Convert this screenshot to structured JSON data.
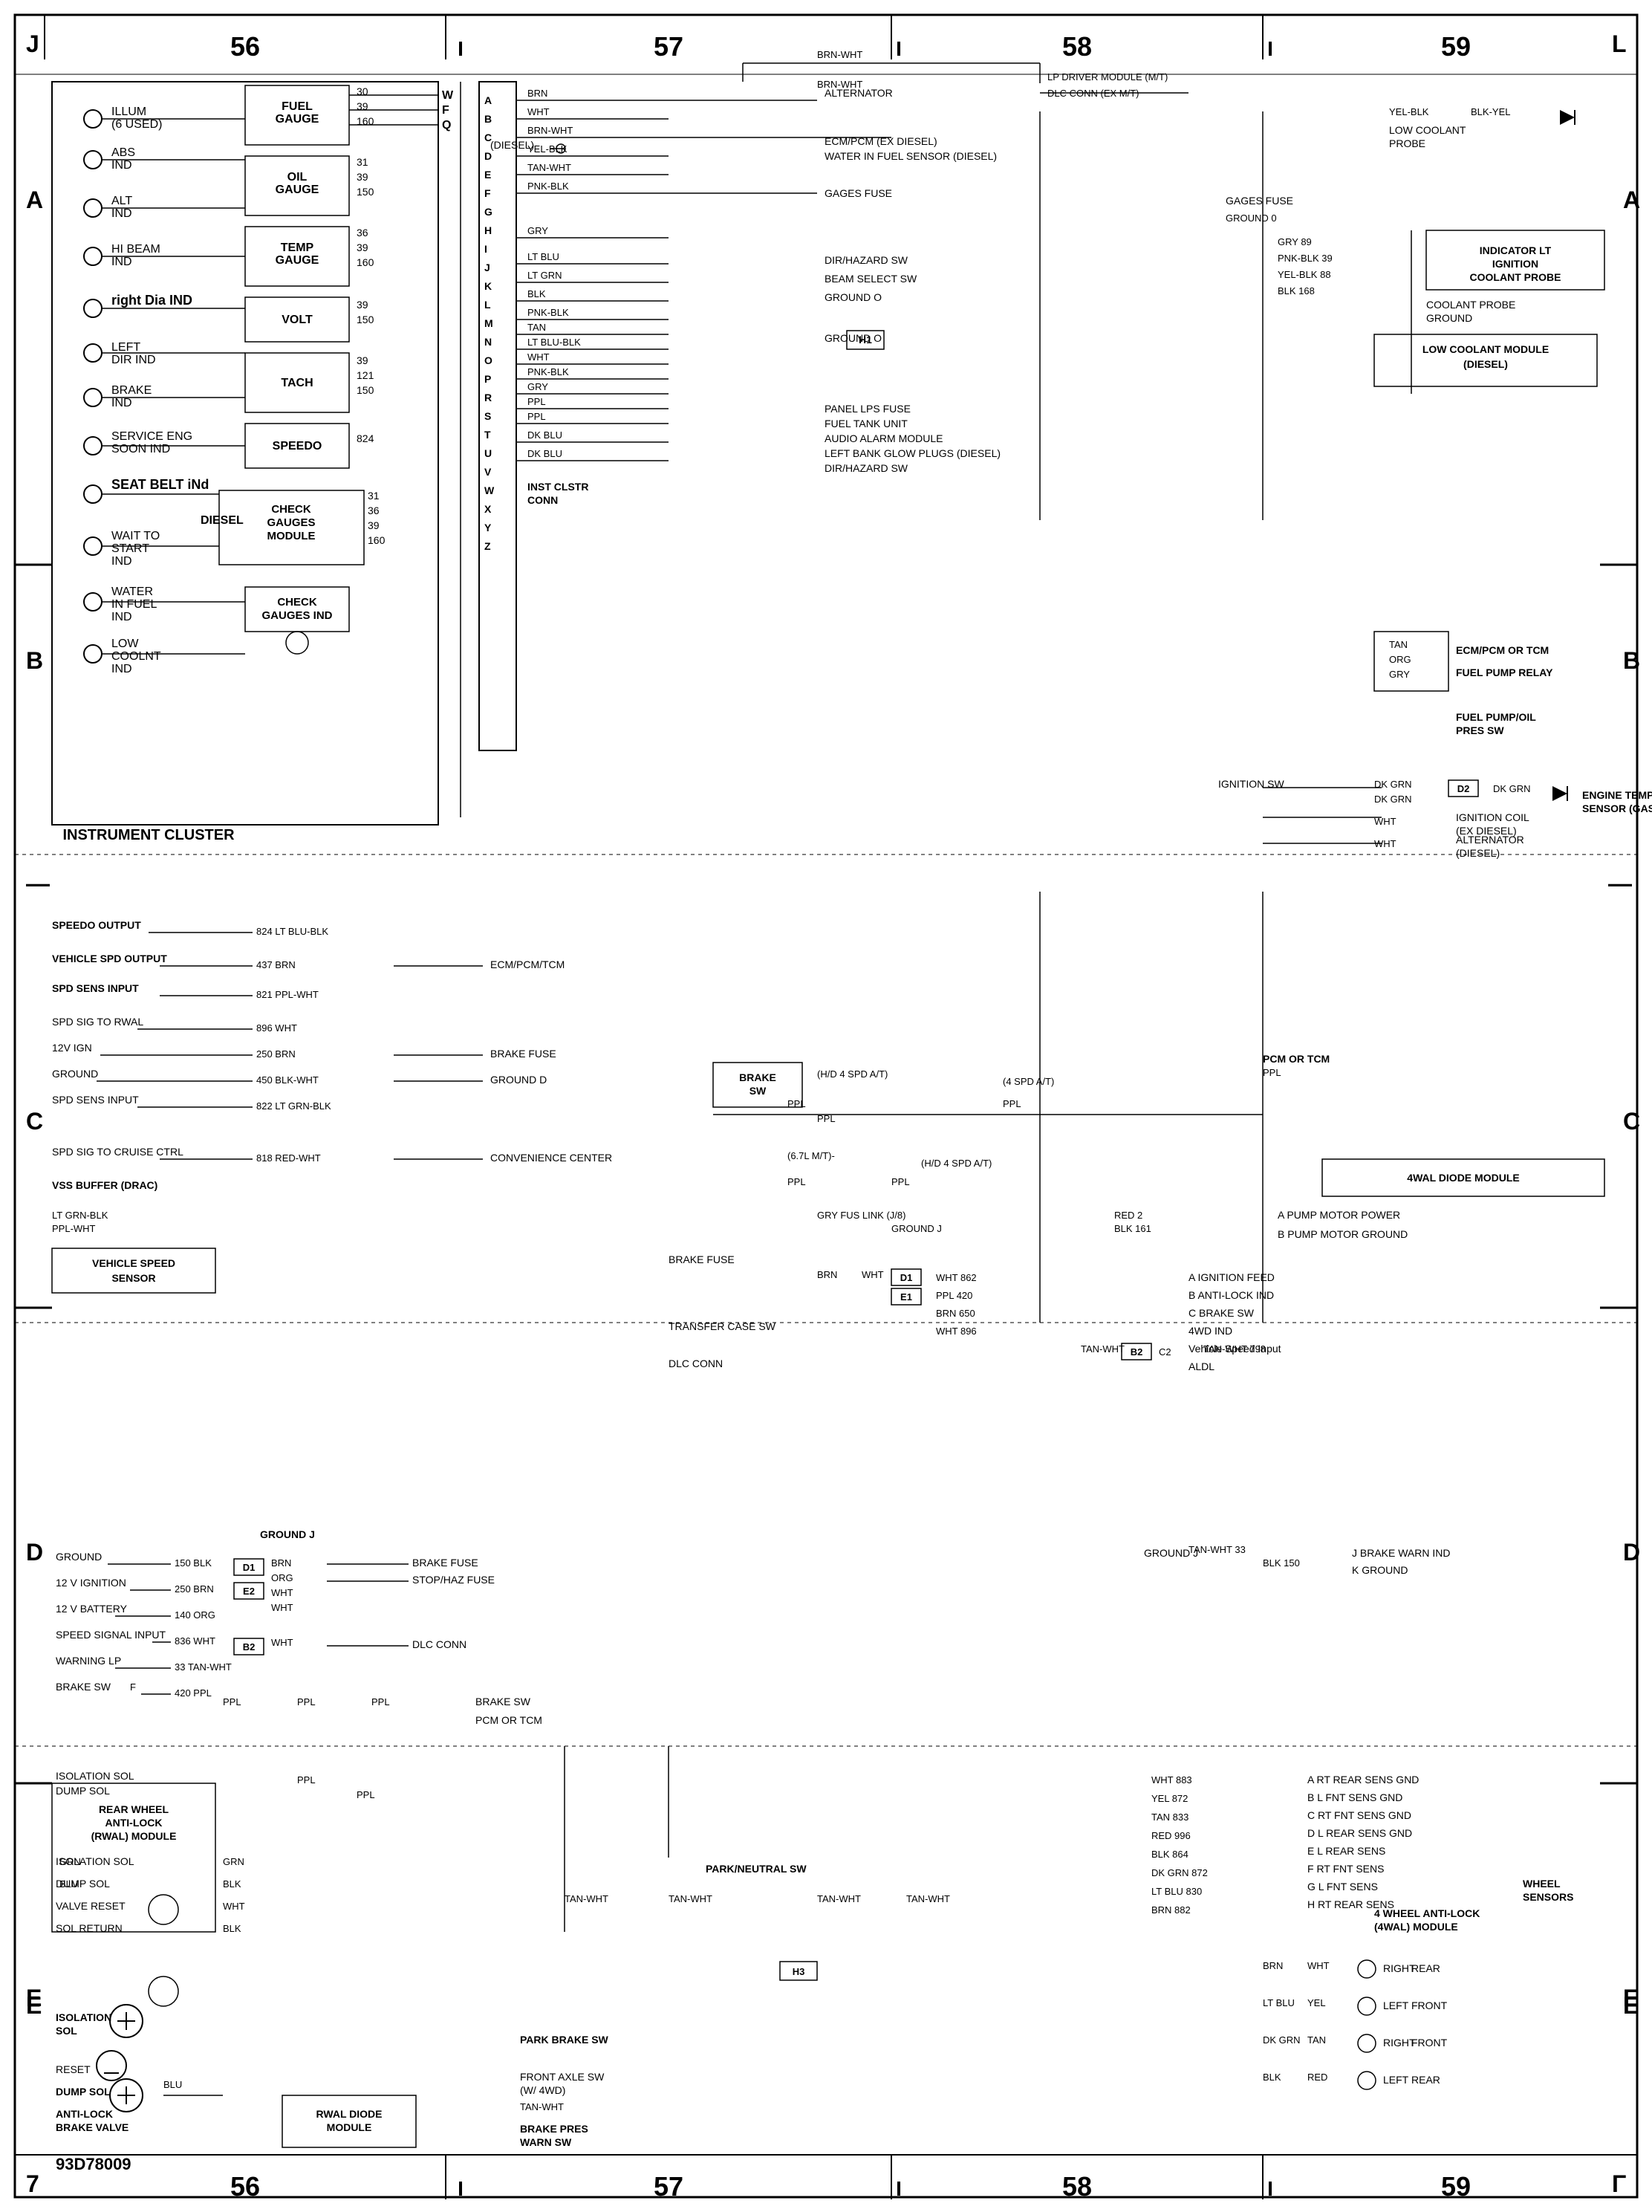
{
  "title": "93D78009 Instrument Cluster Wiring Diagram",
  "columns": [
    "56",
    "57",
    "58",
    "59"
  ],
  "rows": [
    "A",
    "B",
    "C",
    "D",
    "E"
  ],
  "doc_number": "93D78009",
  "gauges": {
    "fuel_gauge": {
      "label": "FUEL GAUGE",
      "values": [
        "30",
        "39",
        "160"
      ]
    },
    "oil_gauge": {
      "label": "OIL GAUGE",
      "values": [
        "31",
        "39",
        "150"
      ]
    },
    "temp_gauge": {
      "label": "TEMP GAUGE",
      "values": [
        "36",
        "39",
        "160"
      ]
    },
    "volt": {
      "label": "VOLT",
      "values": [
        "39",
        "150"
      ]
    },
    "tach": {
      "label": "TACH",
      "values": [
        "39",
        "121",
        "150"
      ]
    },
    "speedo": {
      "label": "SPEEDO",
      "values": [
        "824"
      ]
    },
    "check_gauges_module": {
      "label": "CHECK GAUGES MODULE"
    },
    "check_gauges_ind": {
      "label": "CHECK GAUGES IND"
    },
    "diesel": {
      "label": "DIESEL"
    }
  },
  "indicators": {
    "illum": "ILLUM (6 USED)",
    "abs_ind": "ABS IND",
    "alt_ind": "ALT IND",
    "hi_beam_ind": "HI BEAM IND",
    "right_dir_ind": "RIGHT DIR IND",
    "left_dir_ind": "LEFT DIR IND",
    "brake_ind": "BRAKE IND",
    "service_eng_soon": "SERVICE ENG SOON IND",
    "seat_belt_ind": "SEAT BELT IND",
    "wait_to_start": "WAIT TO START IND",
    "water_in_fuel": "WATER IN FUEL IND",
    "low_coolnt": "LOW COOLNT IND"
  },
  "modules": {
    "instrument_cluster": "INSTRUMENT CLUSTER",
    "rwal_module": "REAR WHEEL ANTI-LOCK (RWAL) MODULE",
    "four_wal_module": "4 WHEEL ANTI-LOCK (4WAL) MODULE",
    "rwal_diode": "RWAL DIODE MODULE",
    "convenience_center": "CONVENIENCE CENTER",
    "ecm_pcm_tcm": "ECM/PCM/TCM",
    "four_wal_diode": "4WAL DIODE MODULE",
    "lp_driver": "LP DRIVER MODULE (M/T)",
    "dlc_conn": "DLC CONN (EX M/T)",
    "alternator": "ALTERNATOR",
    "ecm_pcm_ex": "ECM/PCM (EX DIESEL)",
    "water_fuel_sensor": "WATER IN FUEL SENSOR (DIESEL)",
    "gages_fuse": "GAGES FUSE",
    "indicator_lt": "INDICATOR LT",
    "ignition_coolant": "IGNITION COOLANT PROBE",
    "coolant_probe_gnd": "COOLANT PROBE GROUND",
    "low_coolant_module": "LOW COOLANT MODULE (DIESEL)",
    "fuel_pump_relay": "FUEL PUMP RELAY",
    "fuel_pump_oil_pres": "FUEL PUMP/OIL PRES SW",
    "engine_temp_sensor": "ENGINE TEMP SENSOR (GAS)",
    "ignition_coil": "IGNITION COIL (EX DIESEL)",
    "alternator_diesel": "ALTERNATOR (DIESEL)",
    "low_coolant_probe": "LOW COOLANT PROBE",
    "inst_cluster_conn": "INST CLSTR CONN",
    "park_neutral_sw": "PARK/NEUTRAL SW",
    "park_brake_sw": "PARK BRAKE SW",
    "brake_pres_warn": "BRAKE PRES WARN SW",
    "front_axle_sw": "FRONT AXLE SW (W/ 4WD)",
    "transfer_case_sw": "TRANSFER CASE SW",
    "brake_sw": "BRAKE SW",
    "h1": "H1",
    "h3": "H3",
    "d1": "D1",
    "d2": "D2"
  }
}
